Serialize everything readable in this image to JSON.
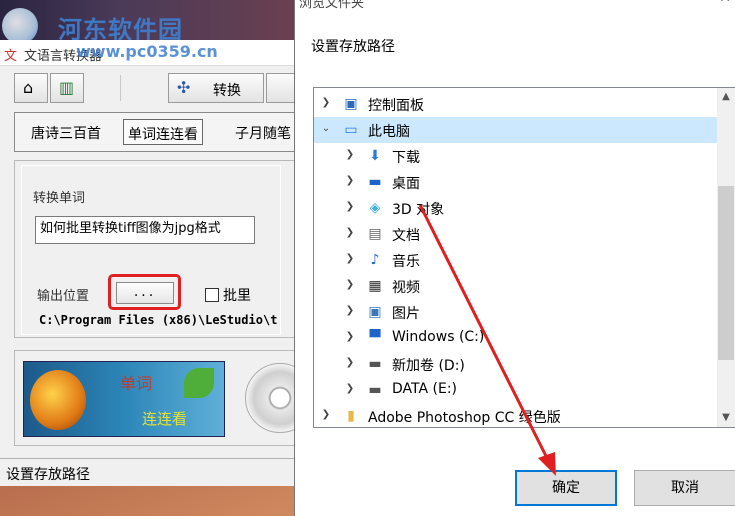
{
  "watermark": {
    "site_name": "河东软件园",
    "url": "www.pc0359.cn"
  },
  "left_window": {
    "title": "文语言转换器",
    "toolbar": {
      "convert_label": "转换"
    },
    "tabs": [
      "唐诗三百首",
      "单词连连看",
      "子月随笔"
    ],
    "convert_word_label": "转换单词",
    "convert_word_value": "如何批里转换tiff图像为jpg格式",
    "output_location_label": "输出位置",
    "browse_label": "...",
    "batch_label": "批里",
    "batch_checked": false,
    "output_path": "C:\\Program Files (x86)\\LeStudio\\t",
    "banner": {
      "line1": "单词",
      "line2": "连连看"
    },
    "status": "设置存放路径"
  },
  "dialog": {
    "title": "浏览文件夹",
    "description": "设置存放路径",
    "tree": [
      {
        "label": "控制面板",
        "icon": "control-panel-icon",
        "expanded": false,
        "selected": false
      },
      {
        "label": "此电脑",
        "icon": "this-pc-icon",
        "expanded": true,
        "selected": true
      },
      {
        "label": "下载",
        "icon": "download-icon",
        "expanded": false,
        "selected": false
      },
      {
        "label": "桌面",
        "icon": "desktop-icon",
        "expanded": false,
        "selected": false
      },
      {
        "label": "3D 对象",
        "icon": "3d-objects-icon",
        "expanded": false,
        "selected": false
      },
      {
        "label": "文档",
        "icon": "document-icon",
        "expanded": false,
        "selected": false
      },
      {
        "label": "音乐",
        "icon": "music-icon",
        "expanded": false,
        "selected": false
      },
      {
        "label": "视频",
        "icon": "video-icon",
        "expanded": false,
        "selected": false
      },
      {
        "label": "图片",
        "icon": "picture-icon",
        "expanded": false,
        "selected": false
      },
      {
        "label": "Windows (C:)",
        "icon": "windows-drive-icon",
        "expanded": false,
        "selected": false
      },
      {
        "label": "新加卷 (D:)",
        "icon": "drive-icon",
        "expanded": false,
        "selected": false
      },
      {
        "label": "DATA (E:)",
        "icon": "drive-icon",
        "expanded": false,
        "selected": false
      },
      {
        "label": "Adobe Photoshop CC 绿色版",
        "icon": "folder-icon",
        "expanded": false,
        "selected": false
      }
    ],
    "ok_label": "确定",
    "cancel_label": "取消"
  },
  "colors": {
    "annotation_red": "#e02020",
    "selection": "#cce8ff",
    "focus_blue": "#0078d7"
  }
}
